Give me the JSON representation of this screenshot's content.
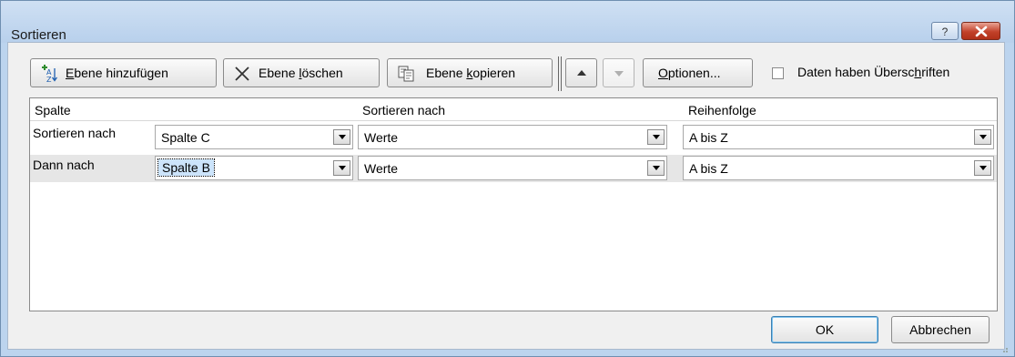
{
  "window": {
    "title": "Sortieren",
    "help_label": "?"
  },
  "toolbar": {
    "add_level_pre": "",
    "add_level_u": "E",
    "add_level_post": "bene hinzufügen",
    "delete_level_pre": "Ebene ",
    "delete_level_u": "l",
    "delete_level_post": "öschen",
    "copy_level_pre": "Ebene ",
    "copy_level_u": "k",
    "copy_level_post": "opieren",
    "options_pre": "",
    "options_u": "O",
    "options_post": "ptionen...",
    "headers_checkbox_pre": "Daten haben Übersc",
    "headers_checkbox_u": "h",
    "headers_checkbox_post": "riften",
    "headers_checked": false
  },
  "grid": {
    "columns": [
      "Spalte",
      "Sortieren nach",
      "Reihenfolge"
    ],
    "rows": [
      {
        "label": "Sortieren nach",
        "column": "Spalte C",
        "sort_on": "Werte",
        "order": "A bis Z",
        "selected": false
      },
      {
        "label": "Dann nach",
        "column": "Spalte B",
        "sort_on": "Werte",
        "order": "A bis Z",
        "selected": true
      }
    ]
  },
  "footer": {
    "ok_label": "OK",
    "cancel_label": "Abbrechen"
  },
  "colors": {
    "title_bar": "#bcd4ee",
    "close_button": "#c2412a",
    "selection": "#cce4fb"
  }
}
